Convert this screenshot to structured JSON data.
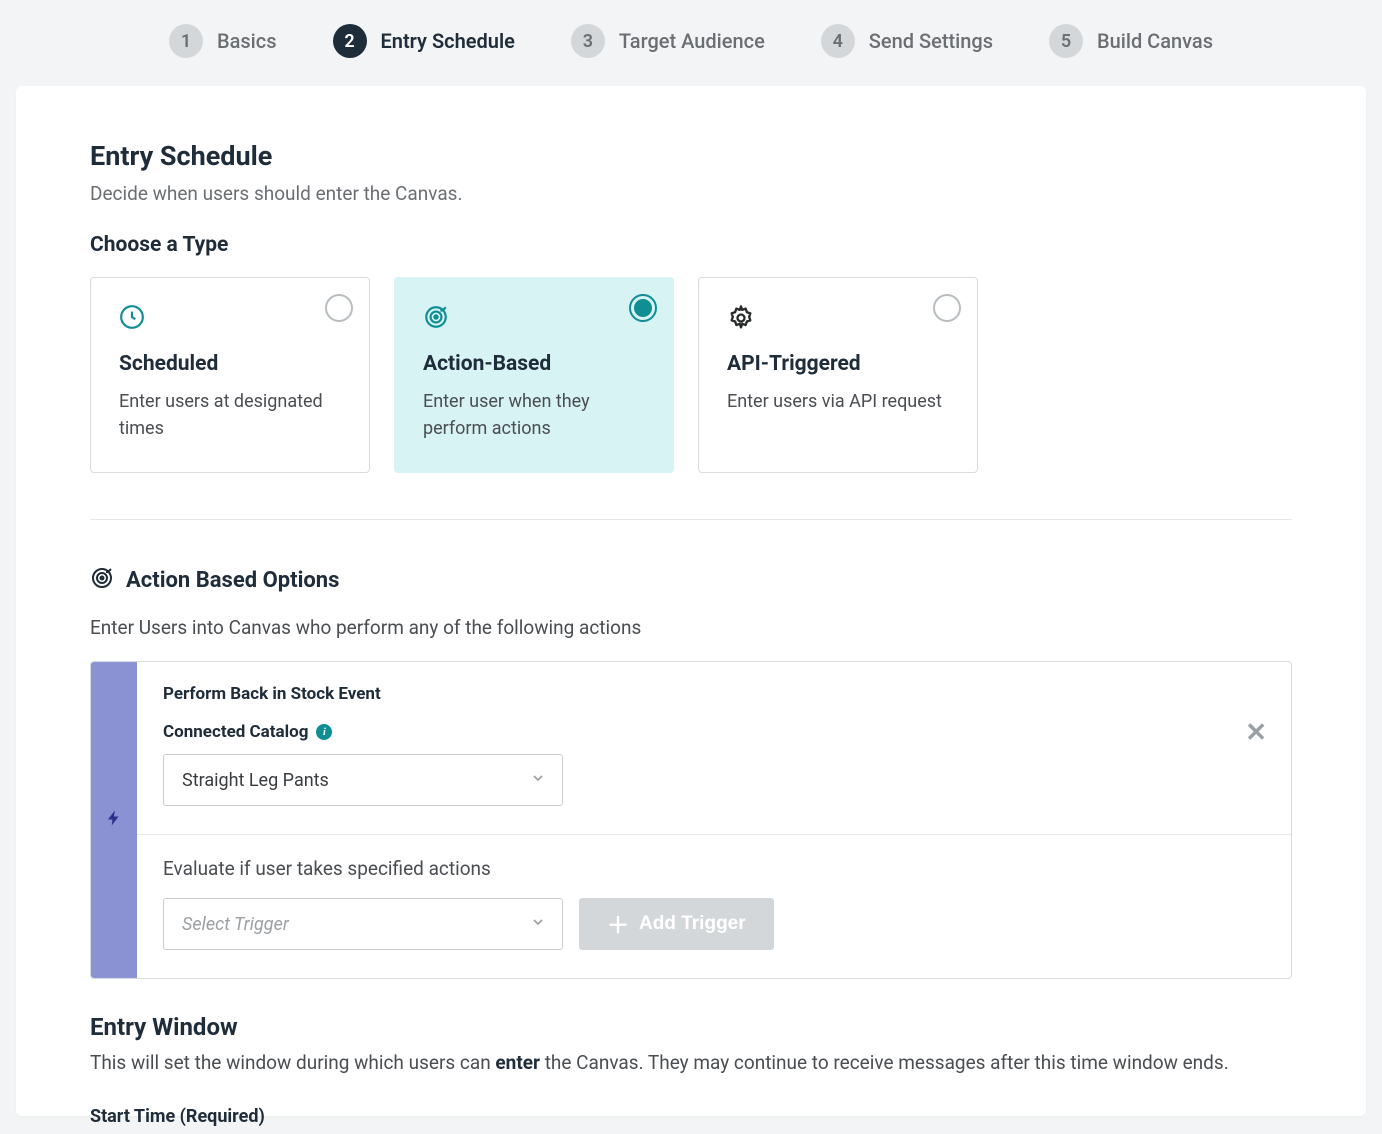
{
  "stepper": {
    "steps": [
      {
        "num": "1",
        "label": "Basics"
      },
      {
        "num": "2",
        "label": "Entry Schedule"
      },
      {
        "num": "3",
        "label": "Target Audience"
      },
      {
        "num": "4",
        "label": "Send Settings"
      },
      {
        "num": "5",
        "label": "Build Canvas"
      }
    ],
    "activeIndex": 1
  },
  "header": {
    "title": "Entry Schedule",
    "subtitle": "Decide when users should enter the Canvas."
  },
  "chooseType": {
    "label": "Choose a Type",
    "cards": [
      {
        "title": "Scheduled",
        "desc": "Enter users at designated times",
        "iconName": "clock-icon"
      },
      {
        "title": "Action-Based",
        "desc": "Enter user when they perform actions",
        "iconName": "target-icon"
      },
      {
        "title": "API-Triggered",
        "desc": "Enter users via API request",
        "iconName": "gear-icon"
      }
    ],
    "selectedIndex": 1
  },
  "actionBased": {
    "title": "Action Based Options",
    "desc": "Enter Users into Canvas who perform any of the following actions",
    "trigger": {
      "heading": "Perform Back in Stock Event",
      "catalogLabel": "Connected Catalog",
      "catalogValue": "Straight Leg Pants",
      "evalLabel": "Evaluate if user takes specified actions",
      "triggerPlaceholder": "Select Trigger",
      "addTriggerLabel": "Add Trigger"
    }
  },
  "entryWindow": {
    "title": "Entry Window",
    "descPrefix": "This will set the window during which users can ",
    "descBold": "enter",
    "descSuffix": " the Canvas. They may continue to receive messages after this time window ends.",
    "startTimeLabel": "Start Time (Required)"
  }
}
